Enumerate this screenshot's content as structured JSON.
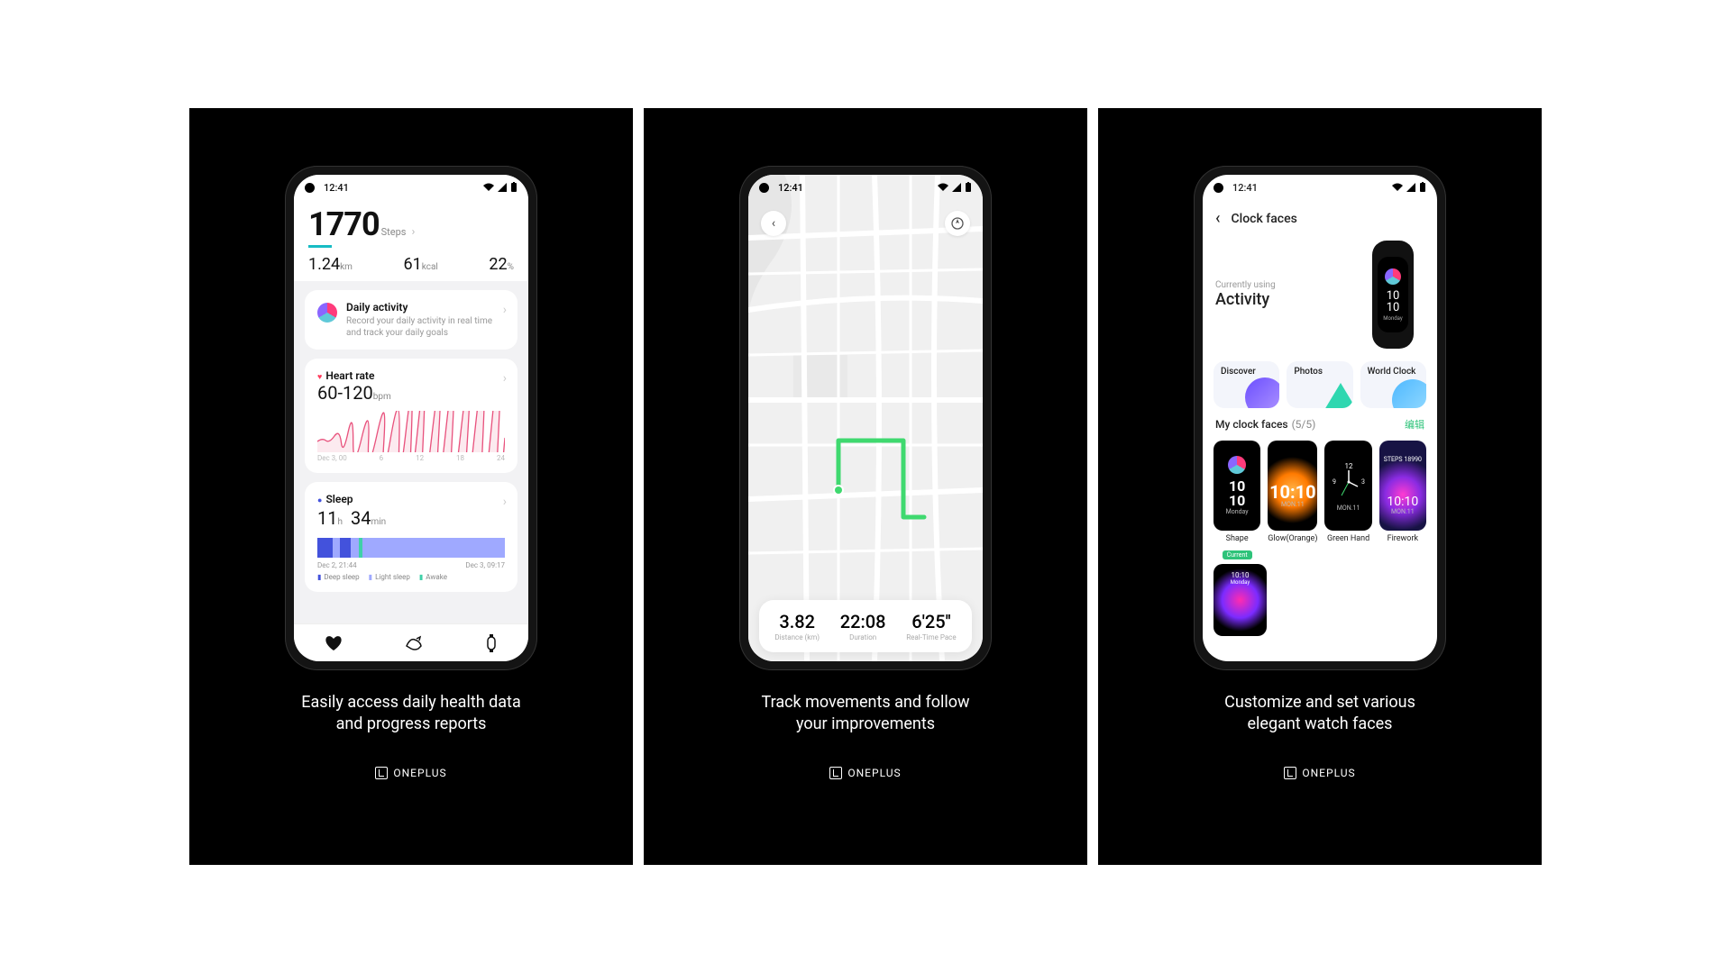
{
  "status": {
    "time": "12:41"
  },
  "brand": "ONEPLUS",
  "panel1": {
    "caption": "Easily access daily health data\nand progress reports",
    "steps": {
      "value": "1770",
      "unit": "Steps"
    },
    "metrics": {
      "distance": {
        "value": "1.24",
        "unit": "km"
      },
      "calories": {
        "value": "61",
        "unit": "kcal"
      },
      "activity": {
        "value": "22",
        "unit": "%"
      }
    },
    "daily": {
      "title": "Daily activity",
      "sub": "Record your daily activity in real time and track your daily goals"
    },
    "hr": {
      "title": "Heart rate",
      "range": "60-120",
      "unit": "bpm",
      "ticks": [
        "Dec 3, 00",
        "6",
        "12",
        "18",
        "24"
      ]
    },
    "sleep": {
      "title": "Sleep",
      "hours": "11",
      "unit_h": "h",
      "mins": "34",
      "unit_m": "min",
      "times": [
        "Dec 2, 21:44",
        "Dec 3, 09:17"
      ],
      "legend": {
        "deep": "Deep sleep",
        "light": "Light sleep",
        "awake": "Awake"
      }
    }
  },
  "panel2": {
    "caption": "Track movements and follow\nyour improvements",
    "run": {
      "distance": {
        "value": "3.82",
        "label": "Distance (km)"
      },
      "duration": {
        "value": "22:08",
        "label": "Duration"
      },
      "pace": {
        "value": "6'25''",
        "label": "Real-Time Pace"
      }
    }
  },
  "panel3": {
    "caption": "Customize and set various\nelegant watch faces",
    "header": "Clock faces",
    "current_label": "Currently using",
    "current_name": "Activity",
    "band": {
      "time_top": "10",
      "time_bot": "10",
      "day": "Monday"
    },
    "tabs": {
      "discover": "Discover",
      "photos": "Photos",
      "world": "World Clock"
    },
    "my_label": "My clock faces",
    "my_count": "(5/5)",
    "edit": "编辑",
    "faces": {
      "shape": {
        "name": "Shape",
        "badge": "Current",
        "t1": "10",
        "t2": "10",
        "day": "Monday"
      },
      "glow": {
        "name": "Glow(Orange)",
        "t": "10:10",
        "day": "MON.11"
      },
      "green": {
        "name": "Green Hand",
        "t": "12",
        "sub": "MON.11"
      },
      "firework": {
        "name": "Firework",
        "steps": "STEPS 18990",
        "t": "10:10",
        "day": "MON.11"
      },
      "extra": {
        "t": "10:10",
        "day": "Monday"
      }
    }
  }
}
